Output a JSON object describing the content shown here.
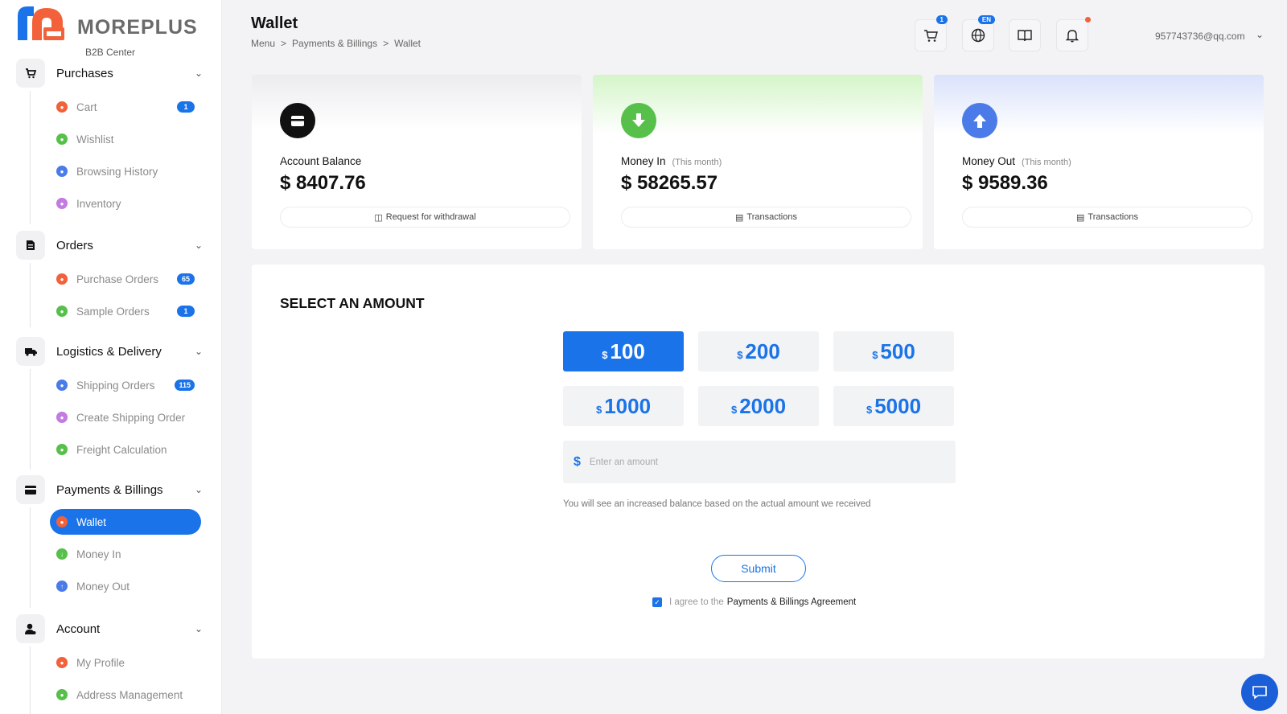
{
  "brand": {
    "name": "MOREPLUS",
    "subtitle": "B2B Center"
  },
  "sidebar": {
    "groups": [
      {
        "label": "Purchases",
        "items": [
          {
            "label": "Cart",
            "badge": "1"
          },
          {
            "label": "Wishlist"
          },
          {
            "label": "Browsing History"
          },
          {
            "label": "Inventory"
          }
        ]
      },
      {
        "label": "Orders",
        "items": [
          {
            "label": "Purchase Orders",
            "badge": "65"
          },
          {
            "label": "Sample Orders",
            "badge": "1"
          }
        ]
      },
      {
        "label": "Logistics & Delivery",
        "items": [
          {
            "label": "Shipping Orders",
            "badge": "115"
          },
          {
            "label": "Create Shipping Order"
          },
          {
            "label": "Freight Calculation"
          }
        ]
      },
      {
        "label": "Payments & Billings",
        "items": [
          {
            "label": "Wallet",
            "active": true
          },
          {
            "label": "Money In"
          },
          {
            "label": "Money Out"
          }
        ]
      },
      {
        "label": "Account",
        "items": [
          {
            "label": "My Profile"
          },
          {
            "label": "Address Management"
          }
        ]
      }
    ]
  },
  "header": {
    "title": "Wallet",
    "breadcrumb": [
      "Menu",
      ">",
      "Payments & Billings",
      ">",
      "Wallet"
    ],
    "cart_badge": "1",
    "lang_badge": "EN",
    "user_email": "957743736@qq.com"
  },
  "cards": {
    "balance": {
      "label": "Account Balance",
      "value": "$ 8407.76",
      "button": "Request for withdrawal"
    },
    "money_in": {
      "label": "Money In",
      "sub": "(This month)",
      "value": "$ 58265.57",
      "button": "Transactions"
    },
    "money_out": {
      "label": "Money Out",
      "sub": "(This month)",
      "value": "$ 9589.36",
      "button": "Transactions"
    }
  },
  "amount": {
    "title": "SELECT AN AMOUNT",
    "currency": "$",
    "options": [
      "100",
      "200",
      "500",
      "1000",
      "2000",
      "5000"
    ],
    "selected": "100",
    "input_placeholder": "Enter an amount",
    "note": "You will see an increased balance based on the actual amount we received",
    "submit": "Submit",
    "agree_prefix": "I agree to the",
    "agree_link": "Payments & Billings Agreement"
  },
  "colors": {
    "accent": "#1a73e8",
    "orange": "#f2613a",
    "green": "#56c04a",
    "blue": "#4a7be8",
    "purple": "#c27be0"
  }
}
